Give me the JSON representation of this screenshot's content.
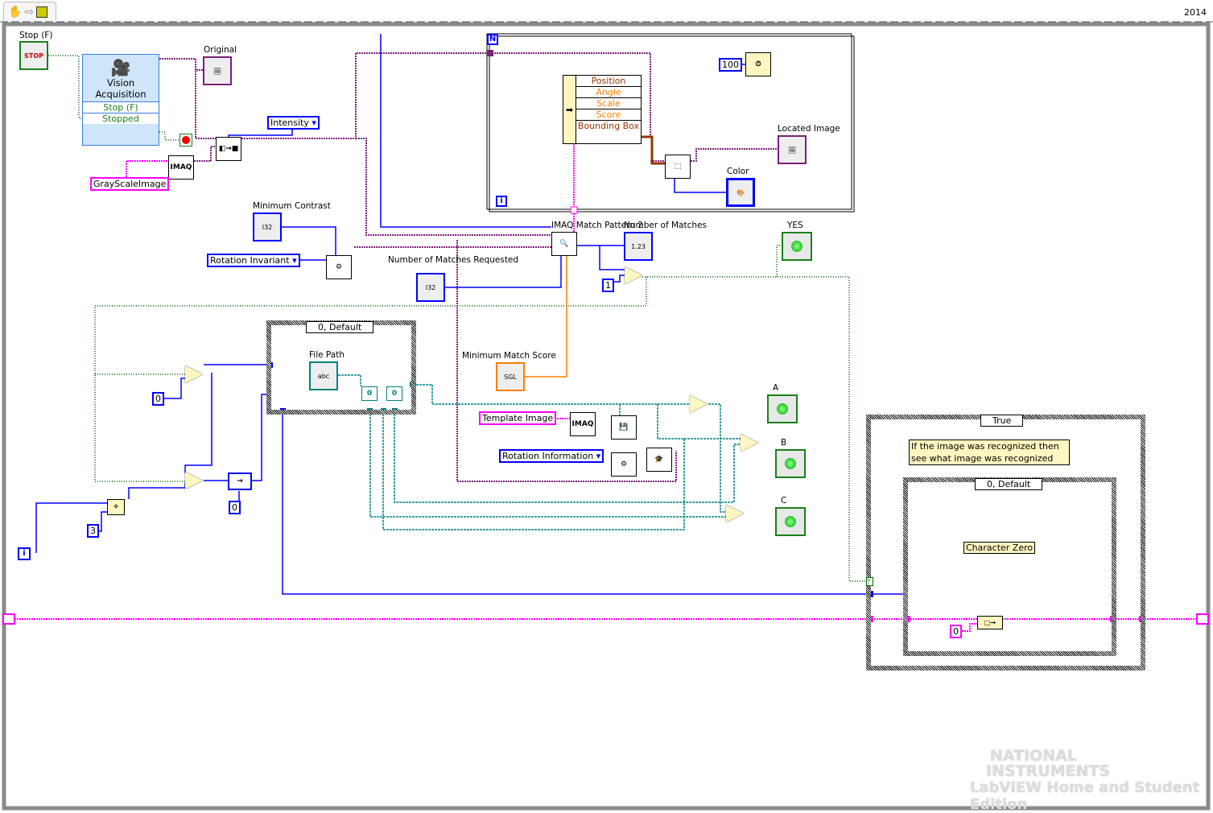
{
  "toolbar": {
    "icons": [
      "hand-tool-icon",
      "arrow-icon",
      "run-icon"
    ],
    "version": "2014"
  },
  "controls": {
    "stop": {
      "label": "Stop (F)",
      "text": "STOP",
      "type": "TF"
    },
    "original": {
      "label": "Original"
    },
    "intensity": {
      "value": "Intensity"
    },
    "grayscale": {
      "value": "GrayScaleImage"
    },
    "min_contrast": {
      "label": "Minimum Contrast",
      "type": "I32"
    },
    "rotation_invariant": {
      "value": "Rotation Invariant"
    },
    "num_matches_requested": {
      "label": "Number of Matches Requested",
      "type": "I32"
    },
    "min_match_score": {
      "label": "Minimum Match Score",
      "type": "SGL"
    },
    "file_path": {
      "label": "File Path"
    },
    "template_image": {
      "value": "Template Image"
    },
    "rotation_info": {
      "value": "Rotation Information"
    },
    "located_image": {
      "label": "Located Image"
    },
    "color": {
      "label": "Color",
      "type": "U32"
    },
    "num_matches": {
      "label": "Number of Matches",
      "value": "1.23",
      "type": "I32"
    },
    "yes": {
      "label": "YES"
    },
    "a": {
      "label": "A"
    },
    "b": {
      "label": "B"
    },
    "c": {
      "label": "C"
    }
  },
  "vision_acq": {
    "title": "Vision Acquisition",
    "inputs": [
      "Stop (F)",
      "Stopped"
    ]
  },
  "match_node": {
    "label": "IMAQ Match Pattern 2"
  },
  "imaq_text": "IMAQ",
  "for_loop": {
    "n": "N",
    "i": "i"
  },
  "while_loop": {
    "i": "i"
  },
  "unbundle": {
    "fields": [
      "Position",
      "Angle",
      "Scale",
      "Score",
      "Bounding Box"
    ]
  },
  "constants": {
    "wait_ms": "100",
    "one": "1",
    "zero_a": "0",
    "zero_b": "0",
    "three": "3",
    "zero_c": "0"
  },
  "case_file": {
    "selector": "0, Default"
  },
  "case_true": {
    "selector": "True",
    "comment": "If the image was recognized then see what image was recognized"
  },
  "case_inner": {
    "selector": "0, Default",
    "label": "Character Zero"
  },
  "watermark": {
    "line1": "NATIONAL",
    "line2": "INSTRUMENTS",
    "line3": "LabVIEW Home and Student Edition"
  },
  "colors": {
    "image_wire": "#7a1f7a",
    "string_wire": "#ff00ff",
    "int_wire": "#0000ff",
    "bool_wire": "#006600",
    "dbl_wire": "#ff7f00",
    "cluster_wire": "#993300",
    "path_wire": "#008080"
  }
}
